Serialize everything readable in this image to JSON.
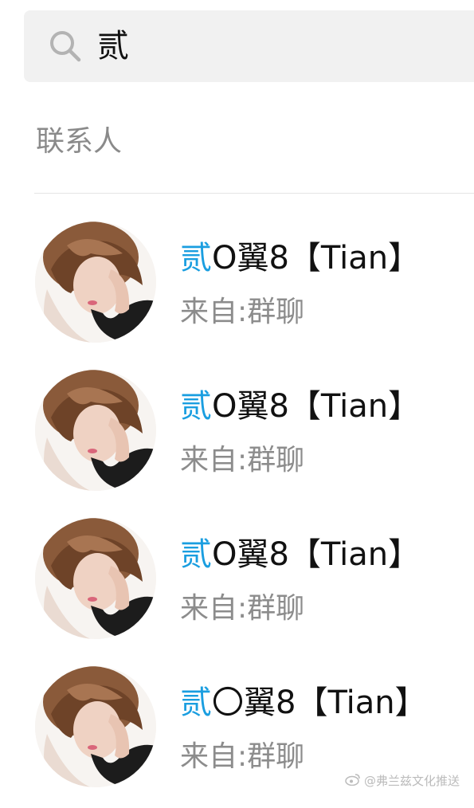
{
  "search": {
    "query": "贰"
  },
  "section": {
    "title": "联系人"
  },
  "contacts": [
    {
      "match": "贰",
      "rest": "O翼8【Tian】",
      "source": "来自:群聊"
    },
    {
      "match": "贰",
      "rest": "O翼8【Tian】",
      "source": "来自:群聊"
    },
    {
      "match": "贰",
      "rest": "O翼8【Tian】",
      "source": "来自:群聊"
    },
    {
      "match": "贰",
      "rest": "〇翼8【Tian】",
      "source": "来自:群聊"
    }
  ],
  "colors": {
    "highlight": "#1a9ee0",
    "search_bg": "#f1f1f1",
    "secondary_text": "#8c8c8c"
  },
  "watermark": {
    "text": "@弗兰兹文化推送"
  }
}
